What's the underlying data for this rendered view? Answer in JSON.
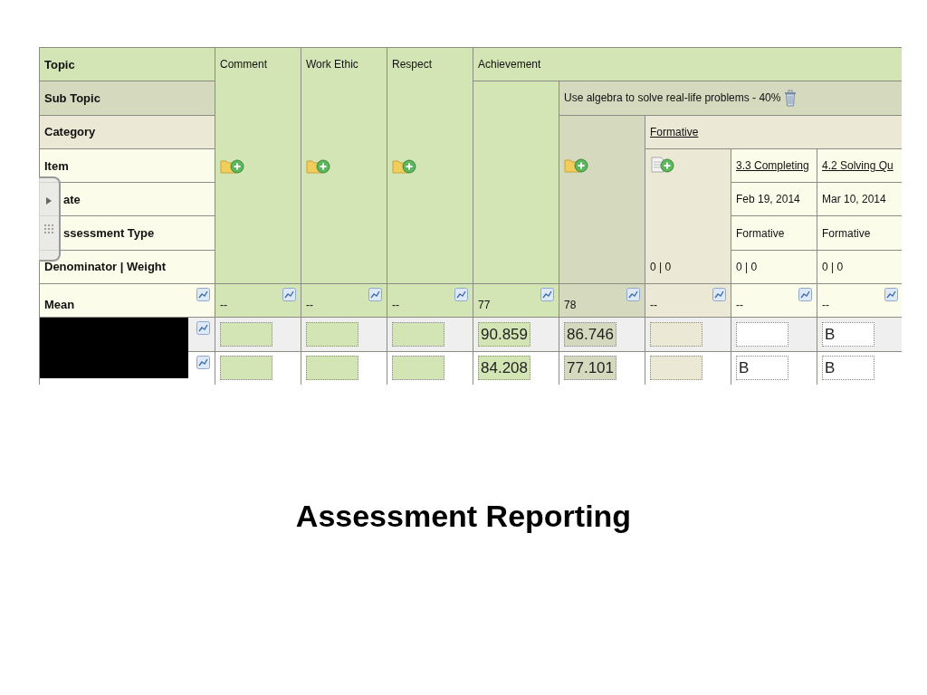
{
  "gradebook": {
    "row_labels": [
      {
        "text": "Topic",
        "kind": "topic"
      },
      {
        "text": "Sub Topic",
        "kind": "subtopic"
      },
      {
        "text": "Category",
        "kind": "category"
      },
      {
        "text": "Item",
        "kind": "item"
      },
      {
        "text": "ate",
        "kind": "item",
        "partly_hidden": true
      },
      {
        "text": "ssessment Type",
        "kind": "item",
        "partly_hidden": true
      },
      {
        "text": "Denominator  |  Weight",
        "kind": "item"
      }
    ],
    "mean_label": "Mean",
    "topics": [
      {
        "title": "Comment",
        "mean": "--"
      },
      {
        "title": "Work Ethic",
        "mean": "--"
      },
      {
        "title": "Respect",
        "mean": "--"
      },
      {
        "title": "Achievement",
        "mean": "77",
        "subtopic": {
          "title": "Use algebra to solve real-life problems - 40%",
          "mean": "78",
          "category": {
            "title": "Formative",
            "denominator": "0 | 0",
            "mean": "--",
            "items": [
              {
                "title": "3.3 Completing",
                "date": "Feb 19, 2014",
                "type": "Formative",
                "denominator": "0 | 0",
                "mean": "--"
              },
              {
                "title": "4.2 Solving Qu",
                "date": "Mar 10, 2014",
                "type": "Formative",
                "denominator": "0 | 0",
                "mean": "--"
              }
            ]
          }
        }
      }
    ],
    "students": [
      {
        "redacted": true,
        "cells": [
          null,
          null,
          null,
          "90.859",
          "86.746",
          null,
          null,
          "B"
        ]
      },
      {
        "redacted": true,
        "cells": [
          null,
          null,
          null,
          "84.208",
          "77.101",
          null,
          "B",
          "B"
        ]
      }
    ]
  },
  "slide_title": "Assessment Reporting"
}
